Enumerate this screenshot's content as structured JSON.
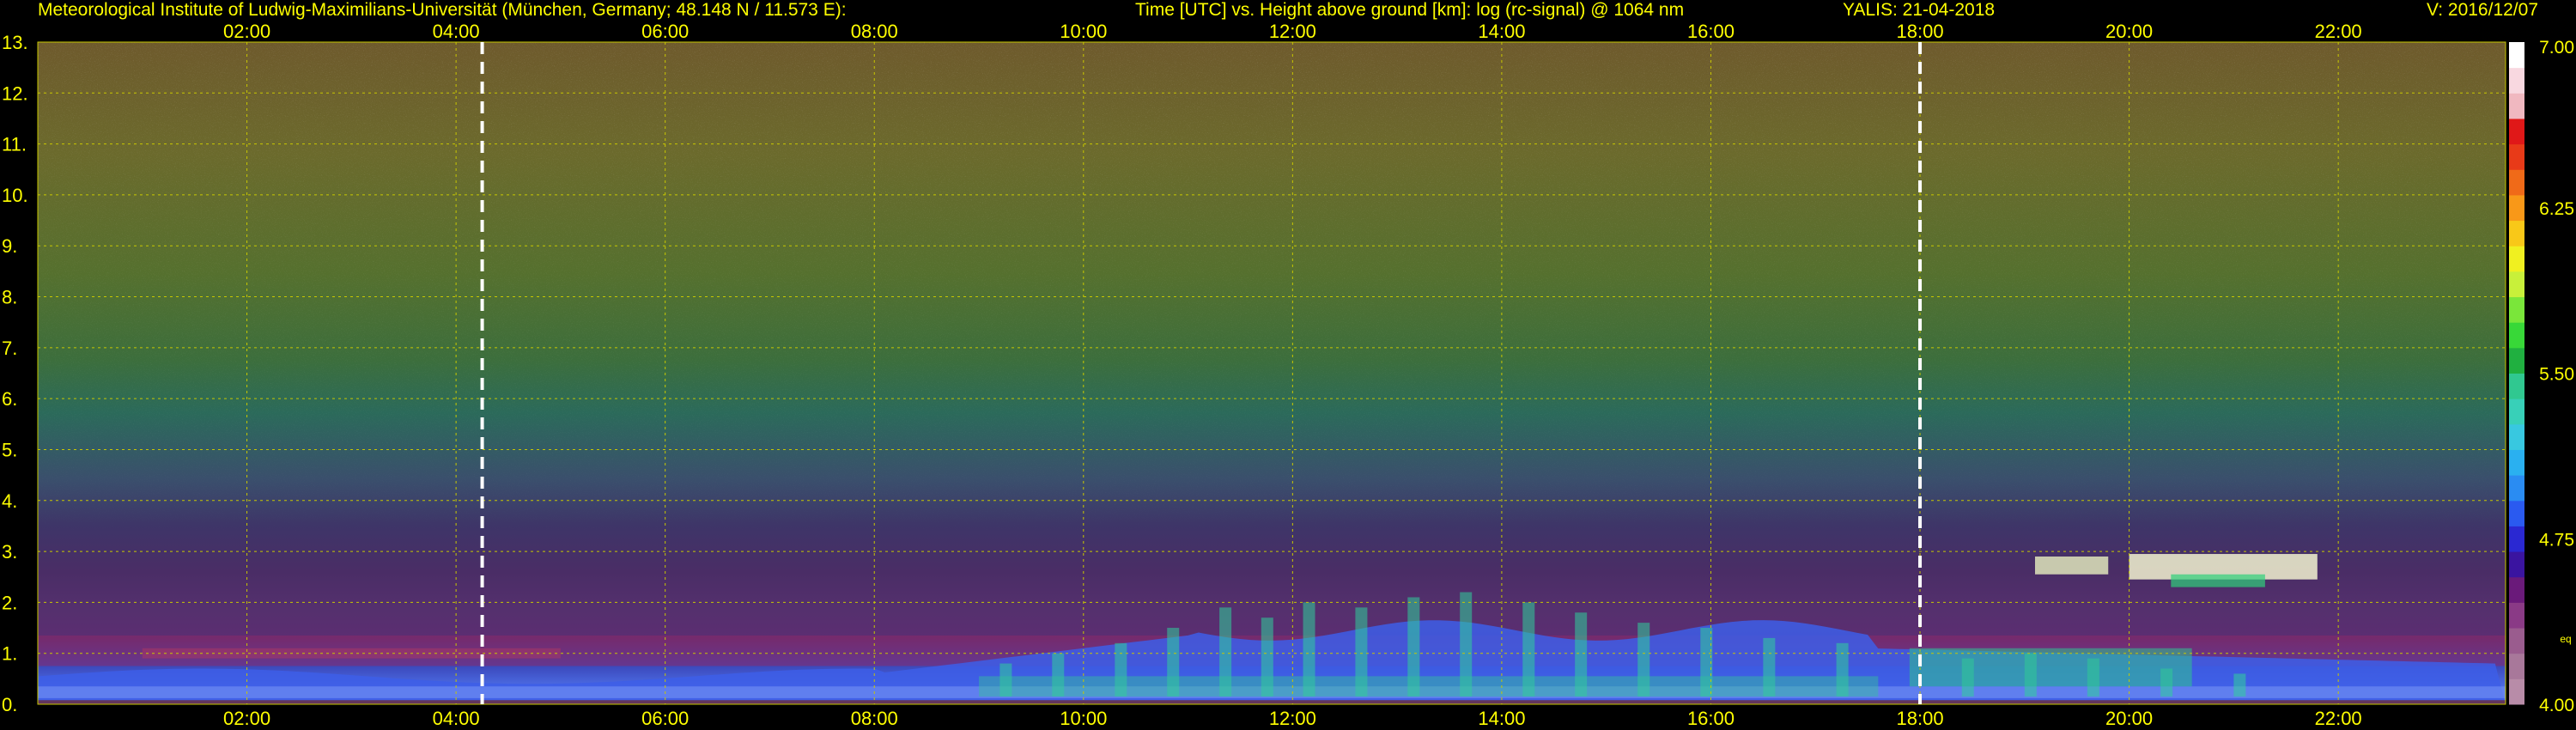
{
  "header": {
    "institute": "Meteorological Institute of Ludwig-Maximilians-Universität (München, Germany; 48.148 N / 11.573 E):",
    "plot_title": "Time [UTC] vs. Height above ground [km]: log (rc-signal) @ 1064 nm",
    "station_date": "YALIS: 21-04-2018",
    "version": "V: 2016/12/07"
  },
  "colors": {
    "text": "#ffff00",
    "grid": "#c8c800",
    "background": "#000000",
    "marker": "#ffffff"
  },
  "chart_data": {
    "type": "heatmap",
    "title": "Time [UTC] vs. Height above ground [km]: log (rc-signal) @ 1064 nm",
    "xlabel": "Time [UTC]",
    "ylabel": "Height above ground [km]",
    "xlim_hours": [
      0.0,
      23.6
    ],
    "ylim_km": [
      0,
      13
    ],
    "x_ticks": [
      "02:00",
      "04:00",
      "06:00",
      "08:00",
      "10:00",
      "12:00",
      "14:00",
      "16:00",
      "18:00",
      "20:00",
      "22:00"
    ],
    "x_tick_hours": [
      2,
      4,
      6,
      8,
      10,
      12,
      14,
      16,
      18,
      20,
      22
    ],
    "y_ticks": [
      "0.",
      "1.",
      "2.",
      "3.",
      "4.",
      "5.",
      "6.",
      "7.",
      "8.",
      "9.",
      "10.",
      "11.",
      "12.",
      "13."
    ],
    "y_tick_values": [
      0,
      1,
      2,
      3,
      4,
      5,
      6,
      7,
      8,
      9,
      10,
      11,
      12,
      13
    ],
    "grid": true,
    "markers_hours": [
      4.25,
      18.0
    ],
    "colorbar": {
      "range": [
        4.0,
        7.0
      ],
      "labels": [
        "7.00",
        "6.25",
        "5.50",
        "4.75",
        "4.00"
      ],
      "label_values": [
        7.0,
        6.25,
        5.5,
        4.75,
        4.0
      ],
      "bottom_note": "eq"
    },
    "layers": [
      {
        "feature": "noise_floor",
        "km_from": 3.0,
        "km_to": 13.0
      },
      {
        "feature": "residual_layer",
        "km_from": 0.7,
        "km_to": 1.3
      },
      {
        "feature": "boundary_layer",
        "km_from": 0.0,
        "km_to": 0.7
      },
      {
        "feature": "convective_plumes",
        "hours_from": 9.0,
        "hours_to": 17.8,
        "km_top": 2.2
      },
      {
        "feature": "cloud_layer",
        "hours_from": 19.0,
        "hours_to": 21.7,
        "km_from": 2.5,
        "km_to": 2.9
      }
    ]
  }
}
